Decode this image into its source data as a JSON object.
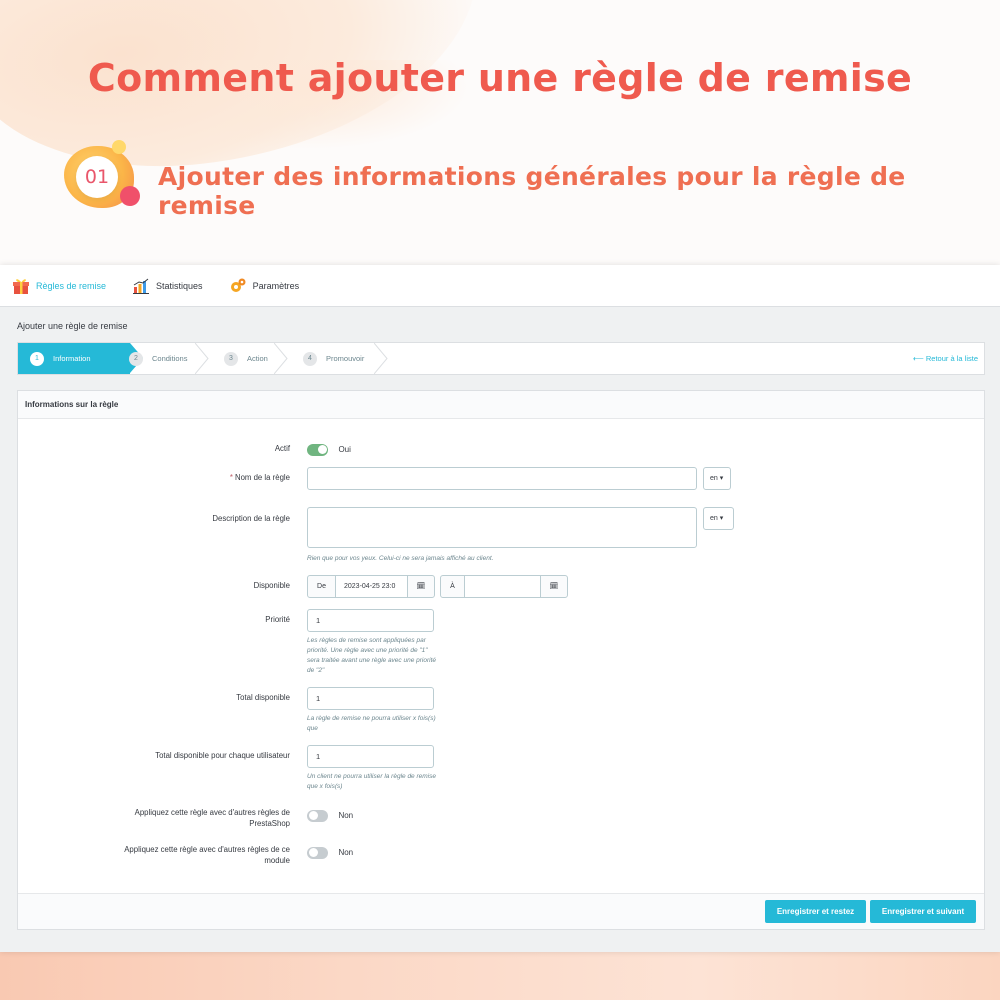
{
  "headline": "Comment ajouter une règle de remise",
  "step_badge": "01",
  "subheadline": "Ajouter des informations générales pour la règle de remise",
  "nav": {
    "items": [
      {
        "label": "Règles de remise",
        "icon": "gift-icon",
        "active": true
      },
      {
        "label": "Statistiques",
        "icon": "bar-chart-icon",
        "active": false
      },
      {
        "label": "Paramètres",
        "icon": "gears-icon",
        "active": false
      }
    ]
  },
  "page_title": "Ajouter une règle de remise",
  "wizard": {
    "steps": [
      {
        "num": "1",
        "label": "Information"
      },
      {
        "num": "2",
        "label": "Conditions"
      },
      {
        "num": "3",
        "label": "Action"
      },
      {
        "num": "4",
        "label": "Promouvoir"
      }
    ],
    "back_link": "Retour à la liste"
  },
  "panel": {
    "title": "Informations sur la règle",
    "actif": {
      "label": "Actif",
      "value": "Oui"
    },
    "name": {
      "label": "Nom de la règle",
      "required_mark": "*",
      "value": "",
      "lang": "en"
    },
    "description": {
      "label": "Description de la règle",
      "value": "",
      "lang": "en",
      "hint": "Rien que pour vos yeux. Celui-ci ne sera jamais affiché au client."
    },
    "available": {
      "label": "Disponible",
      "from_prefix": "De",
      "from_value": "2023-04-25 23:0",
      "to_prefix": "À",
      "to_value": ""
    },
    "priority": {
      "label": "Priorité",
      "value": "1",
      "hint": "Les règles de remise sont appliquées par priorité. Une règle avec une priorité de \"1\" sera traitée avant une règle avec une priorité de \"2\""
    },
    "total": {
      "label": "Total disponible",
      "value": "1",
      "hint": "La règle de remise ne pourra utiliser x fois(s) que"
    },
    "total_user": {
      "label": "Total disponible pour chaque utilisateur",
      "value": "1",
      "hint": "Un client ne pourra utiliser la règle de remise que x fois(s)"
    },
    "combine_prestashop": {
      "label": "Appliquez cette règle avec d'autres règles de PrestaShop",
      "value": "Non"
    },
    "combine_module": {
      "label": "Appliquez cette règle avec d'autres règles de ce module",
      "value": "Non"
    }
  },
  "buttons": {
    "save_stay": "Enregistrer et restez",
    "save_next": "Enregistrer et suivant"
  },
  "colors": {
    "accent": "#25b9d7",
    "headline": "#ef5a4e",
    "toggle_on": "#70b580"
  }
}
